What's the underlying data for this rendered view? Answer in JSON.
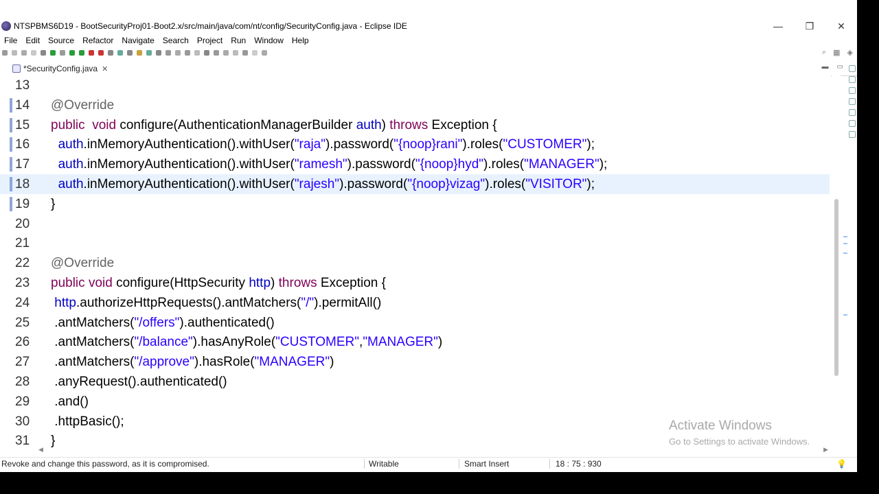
{
  "window": {
    "title": "NTSPBMS6D19 - BootSecurityProj01-Boot2.x/src/main/java/com/nt/config/SecurityConfig.java - Eclipse IDE",
    "minimize": "—",
    "restore": "❐",
    "close": "✕"
  },
  "menu": [
    "File",
    "Edit",
    "Source",
    "Refactor",
    "Navigate",
    "Search",
    "Project",
    "Run",
    "Window",
    "Help"
  ],
  "editor_tab": {
    "label": "*SecurityConfig.java",
    "close": "✕"
  },
  "code_lines": [
    {
      "n": "13",
      "tokens": []
    },
    {
      "n": "14",
      "tokens": [
        [
          "ann",
          "@Override"
        ]
      ]
    },
    {
      "n": "15",
      "tokens": [
        [
          "kw",
          "public"
        ],
        [
          "t",
          "  "
        ],
        [
          "kw",
          "void"
        ],
        [
          "t",
          " configure(AuthenticationManagerBuilder "
        ],
        [
          "var",
          "auth"
        ],
        [
          "t",
          ") "
        ],
        [
          "kw",
          "throws"
        ],
        [
          "t",
          " Exception {"
        ]
      ]
    },
    {
      "n": "16",
      "tokens": [
        [
          "t",
          "  "
        ],
        [
          "var",
          "auth"
        ],
        [
          "t",
          ".inMemoryAuthentication().withUser("
        ],
        [
          "str",
          "\"raja\""
        ],
        [
          "t",
          ").password("
        ],
        [
          "str",
          "\"{noop}rani\""
        ],
        [
          "t",
          ").roles("
        ],
        [
          "str",
          "\"CUSTOMER\""
        ],
        [
          "t",
          ");"
        ]
      ]
    },
    {
      "n": "17",
      "tokens": [
        [
          "t",
          "  "
        ],
        [
          "var",
          "auth"
        ],
        [
          "t",
          ".inMemoryAuthentication().withUser("
        ],
        [
          "str",
          "\"ramesh\""
        ],
        [
          "t",
          ").password("
        ],
        [
          "str",
          "\"{noop}hyd\""
        ],
        [
          "t",
          ").roles("
        ],
        [
          "str",
          "\"MANAGER\""
        ],
        [
          "t",
          ");"
        ]
      ]
    },
    {
      "n": "18",
      "tokens": [
        [
          "t",
          "  "
        ],
        [
          "var",
          "auth"
        ],
        [
          "t",
          ".inMemoryAuthentication().withUser("
        ],
        [
          "str",
          "\"rajesh\""
        ],
        [
          "t",
          ").password("
        ],
        [
          "str",
          "\"{noop}vizag\""
        ],
        [
          "t",
          ").roles("
        ],
        [
          "str",
          "\"VISITOR\""
        ],
        [
          "t",
          ");"
        ]
      ]
    },
    {
      "n": "19",
      "tokens": [
        [
          "t",
          "}"
        ]
      ]
    },
    {
      "n": "20",
      "tokens": []
    },
    {
      "n": "21",
      "tokens": []
    },
    {
      "n": "22",
      "tokens": [
        [
          "ann",
          "@Override"
        ]
      ]
    },
    {
      "n": "23",
      "tokens": [
        [
          "kw",
          "public"
        ],
        [
          "t",
          " "
        ],
        [
          "kw",
          "void"
        ],
        [
          "t",
          " configure(HttpSecurity "
        ],
        [
          "var",
          "http"
        ],
        [
          "t",
          ") "
        ],
        [
          "kw",
          "throws"
        ],
        [
          "t",
          " Exception {"
        ]
      ]
    },
    {
      "n": "24",
      "tokens": [
        [
          "t",
          " "
        ],
        [
          "var",
          "http"
        ],
        [
          "t",
          ".authorizeHttpRequests().antMatchers("
        ],
        [
          "str",
          "\"/\""
        ],
        [
          "t",
          ").permitAll()"
        ]
      ]
    },
    {
      "n": "25",
      "tokens": [
        [
          "t",
          " .antMatchers("
        ],
        [
          "str",
          "\"/offers\""
        ],
        [
          "t",
          ").authenticated()"
        ]
      ]
    },
    {
      "n": "26",
      "tokens": [
        [
          "t",
          " .antMatchers("
        ],
        [
          "str",
          "\"/balance\""
        ],
        [
          "t",
          ").hasAnyRole("
        ],
        [
          "str",
          "\"CUSTOMER\""
        ],
        [
          "t",
          ","
        ],
        [
          "str",
          "\"MANAGER\""
        ],
        [
          "t",
          ")"
        ]
      ]
    },
    {
      "n": "27",
      "tokens": [
        [
          "t",
          " .antMatchers("
        ],
        [
          "str",
          "\"/approve\""
        ],
        [
          "t",
          ").hasRole("
        ],
        [
          "str",
          "\"MANAGER\""
        ],
        [
          "t",
          ")"
        ]
      ]
    },
    {
      "n": "28",
      "tokens": [
        [
          "t",
          " .anyRequest().authenticated()"
        ]
      ]
    },
    {
      "n": "29",
      "tokens": [
        [
          "t",
          " .and()"
        ]
      ]
    },
    {
      "n": "30",
      "tokens": [
        [
          "t",
          " .httpBasic();"
        ]
      ]
    },
    {
      "n": "31",
      "tokens": [
        [
          "t",
          "}"
        ]
      ]
    }
  ],
  "status": {
    "message": "Revoke and change this password, as it is compromised.",
    "writable": "Writable",
    "insert_mode": "Smart Insert",
    "position": "18 : 75 : 930"
  },
  "watermark": {
    "title": "Activate Windows",
    "subtitle": "Go to Settings to activate Windows."
  },
  "colors": {
    "keyword": "#7f0055",
    "annotation": "#646464",
    "string": "#2a00ff",
    "field": "#0000c0",
    "current_line": "#e8f2fe"
  }
}
